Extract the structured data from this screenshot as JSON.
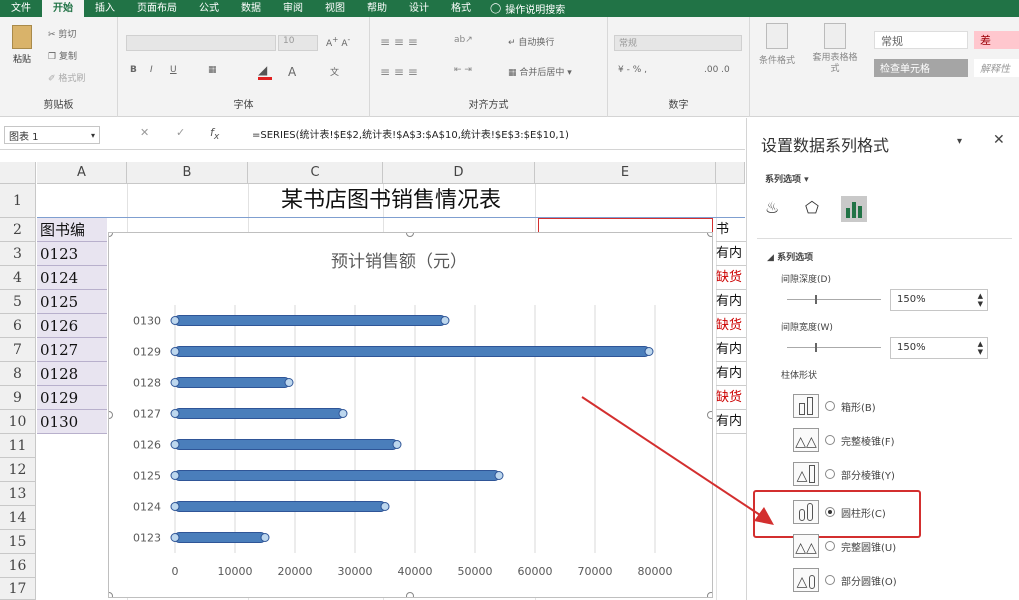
{
  "tabs": [
    "文件",
    "开始",
    "插入",
    "页面布局",
    "公式",
    "数据",
    "审阅",
    "视图",
    "帮助",
    "设计",
    "格式"
  ],
  "tell_me": "操作说明搜索",
  "ribbon": {
    "clipboard": {
      "paste": "粘贴",
      "cut": "剪切",
      "copy": "复制",
      "painter": "格式刷",
      "label": "剪贴板"
    },
    "font": {
      "size": "10",
      "label": "字体"
    },
    "align": {
      "wrap": "自动换行",
      "merge": "合并后居中",
      "label": "对齐方式"
    },
    "number": {
      "format": "常规",
      "label": "数字"
    },
    "styles": {
      "cond": "条件格式",
      "table": "套用表格格式",
      "normal": "常规",
      "bad": "差",
      "check": "检查单元格",
      "explain": "解释性文本"
    }
  },
  "namebox": "图表 1",
  "formula": "=SERIES(统计表!$E$2,统计表!$A$3:$A$10,统计表!$E$3:$E$10,1)",
  "columns": [
    "A",
    "B",
    "C",
    "D",
    "E"
  ],
  "rows": [
    "1",
    "2",
    "3",
    "4",
    "5",
    "6",
    "7",
    "8",
    "9",
    "10",
    "11",
    "12",
    "13",
    "14",
    "15",
    "16",
    "17"
  ],
  "sheet": {
    "title": "某书店图书销售情况表",
    "a2": "图书编",
    "a_codes": [
      "0123",
      "0124",
      "0125",
      "0126",
      "0127",
      "0128",
      "0129",
      "0130"
    ],
    "f_col": [
      "书",
      "有内",
      "缺货",
      "有内",
      "缺货",
      "有内",
      "有内",
      "缺货",
      "有内"
    ]
  },
  "chart_data": {
    "type": "bar",
    "title": "预计销售额（元）",
    "categories": [
      "0123",
      "0124",
      "0125",
      "0126",
      "0127",
      "0128",
      "0129",
      "0130"
    ],
    "values": [
      15000,
      35000,
      54000,
      37000,
      28000,
      19000,
      79000,
      45000
    ],
    "xlim": [
      0,
      80000
    ],
    "xticks": [
      "0",
      "10000",
      "20000",
      "30000",
      "40000",
      "50000",
      "60000",
      "70000",
      "80000"
    ],
    "grid": true,
    "color": "#4a7ebb"
  },
  "pane": {
    "title": "设置数据系列格式",
    "series_opts": "系列选项",
    "section": "系列选项",
    "gap_depth_label": "间隙深度(D)",
    "gap_depth": "150%",
    "gap_width_label": "间隙宽度(W)",
    "gap_width": "150%",
    "shape_label": "柱体形状",
    "shapes": [
      "箱形(B)",
      "完整棱锥(F)",
      "部分棱锥(Y)",
      "圆柱形(C)",
      "完整圆锥(U)",
      "部分圆锥(O)"
    ],
    "selected_shape": "圆柱形(C)"
  },
  "colors": {
    "excel_green": "#217346",
    "highlight": "#d32f2f",
    "bar": "#4a7ebb"
  }
}
